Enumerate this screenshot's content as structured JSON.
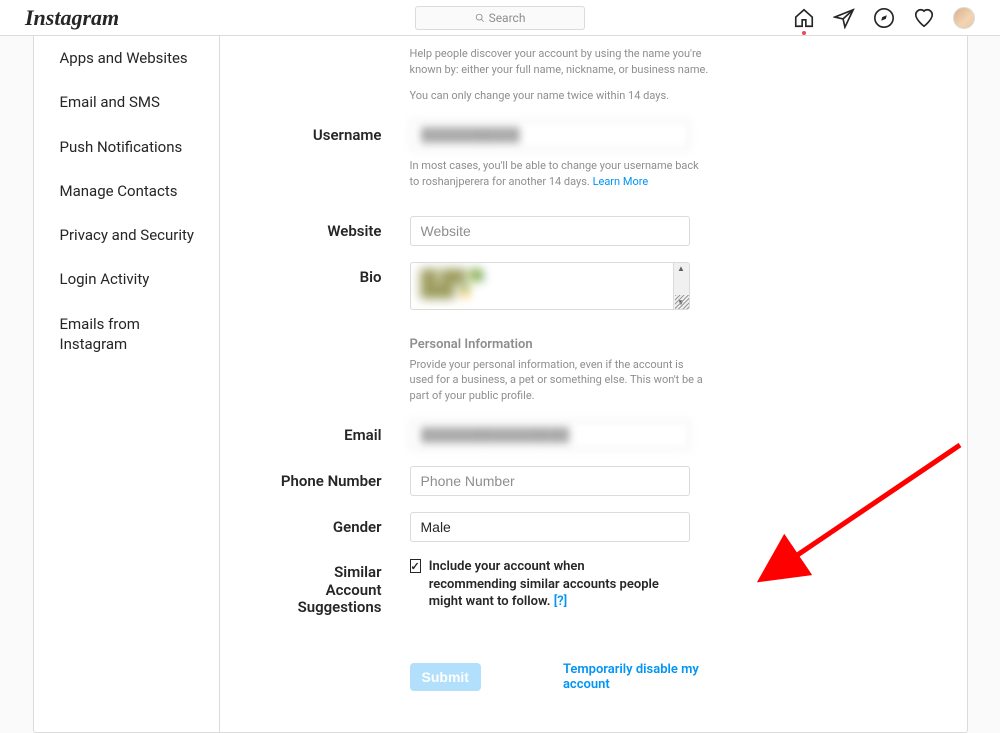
{
  "brand": "Instagram",
  "search": {
    "placeholder": "Search"
  },
  "sidebar": {
    "items": [
      {
        "label": "Apps and Websites"
      },
      {
        "label": "Email and SMS"
      },
      {
        "label": "Push Notifications"
      },
      {
        "label": "Manage Contacts"
      },
      {
        "label": "Privacy and Security"
      },
      {
        "label": "Login Activity"
      },
      {
        "label": "Emails from Instagram"
      }
    ]
  },
  "name_help": {
    "line1": "Help people discover your account by using the name you're known by: either your full name, nickname, or business name.",
    "line2": "You can only change your name twice within 14 days."
  },
  "labels": {
    "username": "Username",
    "website": "Website",
    "bio": "Bio",
    "email": "Email",
    "phone": "Phone Number",
    "gender": "Gender",
    "similar1": "Similar Account",
    "similar2": "Suggestions"
  },
  "username_help": {
    "text": "In most cases, you'll be able to change your username back to roshanjperera for another 14 days.",
    "link": "Learn More"
  },
  "website": {
    "placeholder": "Website",
    "value": ""
  },
  "personal_info": {
    "title": "Personal Information",
    "text": "Provide your personal information, even if the account is used for a business, a pet or something else. This won't be a part of your public profile."
  },
  "phone": {
    "placeholder": "Phone Number",
    "value": ""
  },
  "gender": {
    "value": "Male"
  },
  "similar_checkbox": {
    "checked": true,
    "label": "Include your account when recommending similar accounts people might want to follow.",
    "help": "[?]"
  },
  "actions": {
    "submit": "Submit",
    "disable": "Temporarily disable my account"
  }
}
